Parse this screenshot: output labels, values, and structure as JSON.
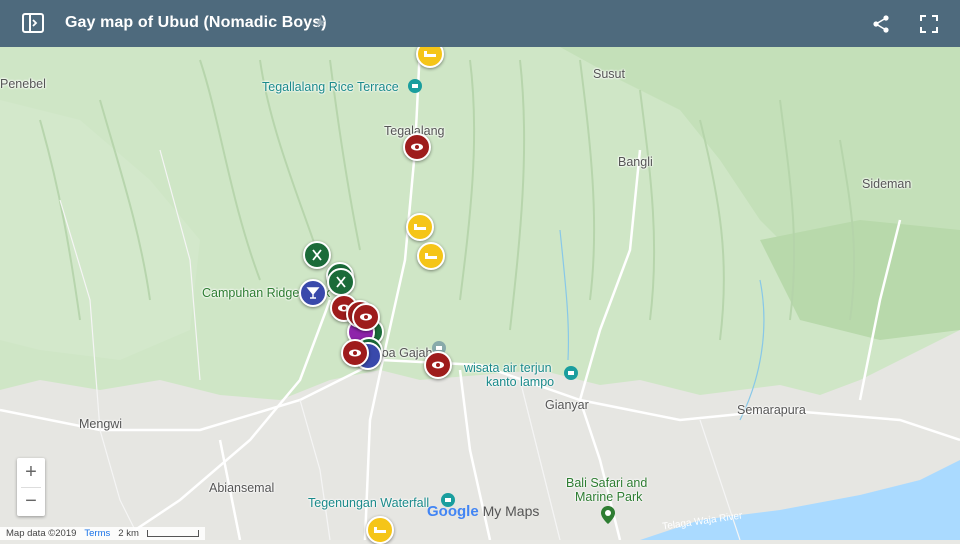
{
  "header": {
    "title": "Gay map of Ubud (Nomadic Boys)",
    "star": "★",
    "colors": {
      "bar": "#4e6a7d"
    }
  },
  "places": {
    "penebel": "Penebel",
    "tegallalang_rice": "Tegallalang Rice Terrace",
    "susut": "Susut",
    "tegalalang": "Tegalalang",
    "bangli": "Bangli",
    "sideman": "Sideman",
    "campuhan": "Campuhan Ridge Walk",
    "goa_gajah": "Goa Gajah",
    "wisata1": "wisata air terjun",
    "wisata2": "kanto lampo",
    "gianyar": "Gianyar",
    "mengwi": "Mengwi",
    "semarapura": "Semarapura",
    "abiansemal": "Abiansemal",
    "tegenungan": "Tegenungan Waterfall",
    "bali_safari1": "Bali Safari and",
    "bali_safari2": "Marine Park",
    "river": "Telaga Waja River"
  },
  "pins": {
    "colors": {
      "sight": "#9e1c1c",
      "food": "#1b6b39",
      "bar": "#3949ab",
      "hotel": "#f5c518"
    },
    "icons": {
      "sight": "eye-icon",
      "food": "fork-knife-icon",
      "bar": "cocktail-icon",
      "hotel": "bed-icon"
    }
  },
  "controls": {
    "zoom_in": "+",
    "zoom_out": "−"
  },
  "footer": {
    "map_data": "Map data ©2019",
    "terms": "Terms",
    "scale": "2 km"
  },
  "brand": {
    "google": "Google",
    "my_maps": "My Maps"
  }
}
